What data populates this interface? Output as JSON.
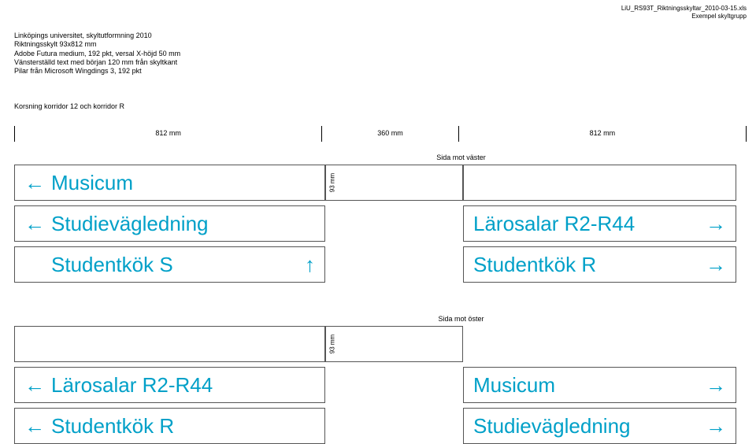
{
  "header": {
    "filename": "LiU_RS93T_Riktningsskyltar_2010-03-15.xls",
    "subtitle": "Exempel skyltgrupp"
  },
  "meta": {
    "line1": "Linköpings universitet, skyltutformning 2010",
    "line2": "Riktningsskylt 93x812 mm",
    "line3": "Adobe Futura medium, 192 pkt,  versal X-höjd 50 mm",
    "line4": "Vänsterställd text med början 120 mm från skyltkant",
    "line5": "Pilar från Microsoft Wingdings 3, 192 pkt"
  },
  "location": "Korsning korridor 12 och korridor R",
  "dimensions": {
    "d1": "812 mm",
    "d2": "360 mm",
    "d3": "812 mm"
  },
  "group1": {
    "side_label": "Sida mot väster",
    "vlabel": "93 mm",
    "left": {
      "s1": "Musicum",
      "s2": "Studievägledning",
      "s3": "Studentkök S"
    },
    "right": {
      "s1": "Lärosalar R2-R44",
      "s2": "Studentkök R"
    }
  },
  "group2": {
    "side_label": "Sida mot öster",
    "vlabel": "93 mm",
    "left": {
      "s1": "Lärosalar R2-R44",
      "s2": "Studentkök R"
    },
    "right": {
      "s1": "Musicum",
      "s2": "Studievägledning"
    }
  },
  "arrows": {
    "left": "←",
    "right": "→",
    "up": "↑"
  }
}
